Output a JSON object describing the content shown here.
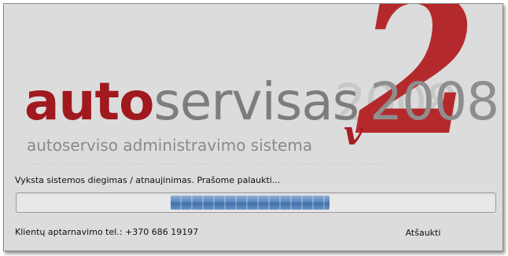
{
  "logo": {
    "part_red": "auto",
    "part_grey": "servisas",
    "year": "2008",
    "version_letter": "v",
    "version_number": "2",
    "tagline": "autoserviso administravimo sistema",
    "brand_red": "#a0191f",
    "brand_grey": "#7d7d7d"
  },
  "install": {
    "status_text": "Vyksta sistemos diegimas / atnaujinimas. Prašome palaukti...",
    "progress_indeterminate": true,
    "progress_fill_color": "#5a87bd"
  },
  "footer": {
    "support_text": "Klientų aptarnavimo tel.: +370 686 19197",
    "cancel_label": "Atšaukti"
  }
}
